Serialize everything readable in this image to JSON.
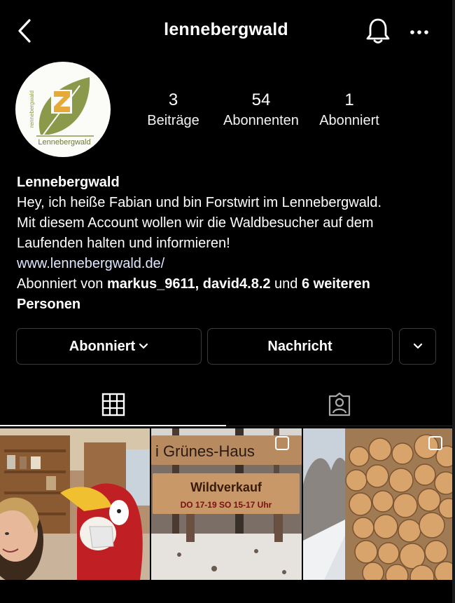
{
  "header": {
    "username": "lennebergwald",
    "back_icon": "chevron-left-icon",
    "bell_icon": "bell-icon",
    "more_icon": "more-horizontal-icon"
  },
  "avatar": {
    "logo_text": "Lennebergwald",
    "logo_side_text": "rennebergwald",
    "letter": "Z",
    "colors": {
      "leaf": "#8a9a4a",
      "letter": "#e6a93a"
    }
  },
  "stats": [
    {
      "value": "3",
      "label": "Beiträge"
    },
    {
      "value": "54",
      "label": "Abonnenten"
    },
    {
      "value": "1",
      "label": "Abonniert"
    }
  ],
  "bio": {
    "name": "Lennebergwald",
    "line1": "Hey, ich heiße Fabian und bin Forstwirt im Lennebergwald.",
    "line2": "Mit diesem Account wollen wir die Waldbesucher auf dem",
    "line3": "Laufenden halten und informieren!",
    "link": "www.lennebergwald.de/",
    "followed_prefix": "Abonniert von ",
    "followed_user1": "markus_9611",
    "followed_sep": ", ",
    "followed_user2": "david4.8.2",
    "followed_and": " und ",
    "followed_more": "6 weiteren",
    "followed_more2": "Personen"
  },
  "buttons": {
    "follow": "Abonniert",
    "message": "Nachricht"
  },
  "tabs": {
    "grid_icon": "grid-icon",
    "tagged_icon": "tagged-person-icon"
  },
  "posts": [
    {
      "kind": "photo",
      "desc": "shop-with-parrot"
    },
    {
      "kind": "photo",
      "sign_line1": "i Grünes-Haus",
      "sign_line2": "Wildverkauf",
      "sign_line3": "DO 17-19   SO 15-17 Uhr"
    },
    {
      "kind": "photo",
      "desc": "stacked-logs"
    }
  ],
  "colors": {
    "background": "#000000",
    "text": "#ffffff",
    "button_border": "#3a3a3a"
  }
}
